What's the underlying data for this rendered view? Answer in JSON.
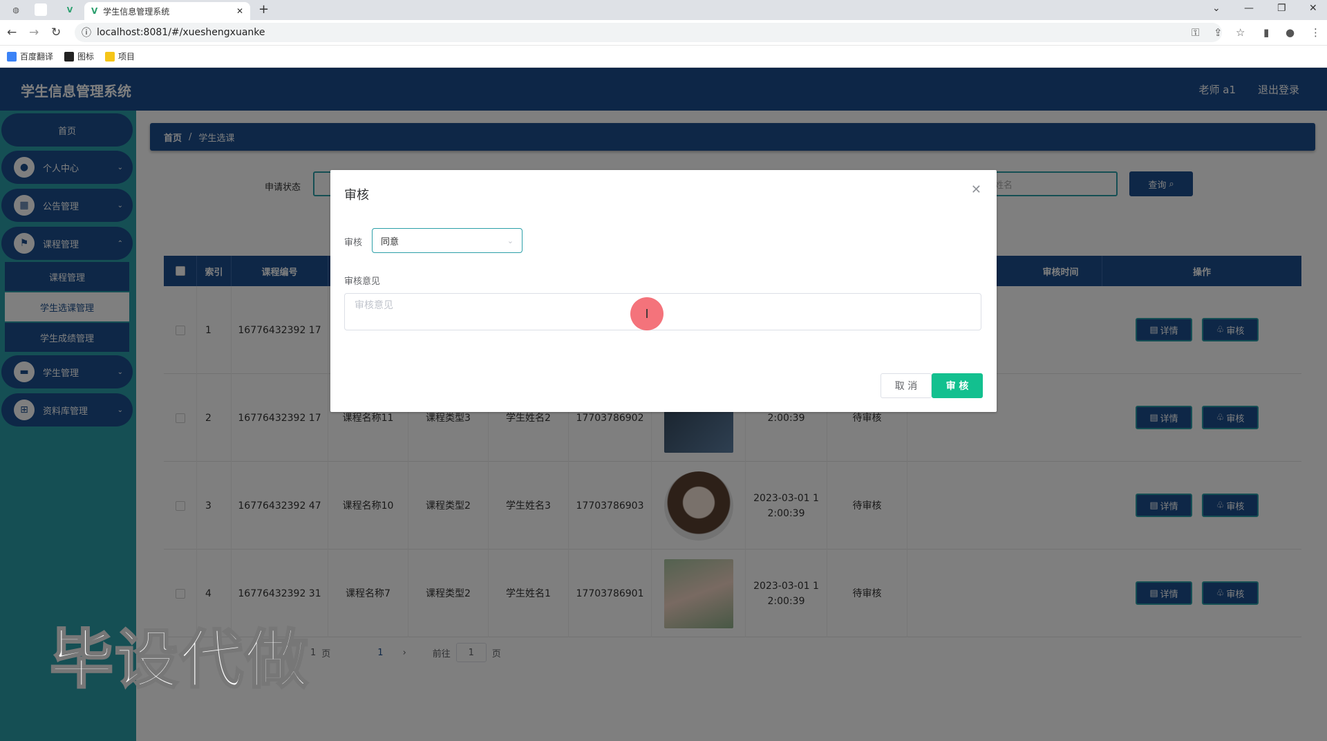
{
  "browser": {
    "tab_title": "学生信息管理系统",
    "url": "localhost:8081/#/xueshengxuanke",
    "bookmarks": [
      "百度翻译",
      "图标",
      "项目"
    ]
  },
  "header": {
    "brand": "学生信息管理系统",
    "user": "老师 a1",
    "logout": "退出登录"
  },
  "sidebar": {
    "home": "首页",
    "items": [
      {
        "label": "个人中心"
      },
      {
        "label": "公告管理"
      },
      {
        "label": "课程管理"
      },
      {
        "label": "学生管理"
      },
      {
        "label": "资料库管理"
      }
    ],
    "subitems": [
      "课程管理",
      "学生选课管理",
      "学生成绩管理"
    ]
  },
  "breadcrumb": {
    "home": "首页",
    "sep": "/",
    "current": "学生选课"
  },
  "search": {
    "status_label": "申请状态",
    "name_placeholder": "姓名",
    "query_button": "查询"
  },
  "table": {
    "headers": [
      "索引",
      "课程编号",
      "审核时间",
      "操作"
    ],
    "rows": [
      {
        "index": "1",
        "course_no": "16776432392 17",
        "course_name": "",
        "course_type": "",
        "student": "",
        "phone": "",
        "time": "",
        "status": ""
      },
      {
        "index": "2",
        "course_no": "16776432392 17",
        "course_name": "课程名称11",
        "course_type": "课程类型3",
        "student": "学生姓名2",
        "phone": "17703786902",
        "time": "2:00:39",
        "status": "待审核"
      },
      {
        "index": "3",
        "course_no": "16776432392 47",
        "course_name": "课程名称10",
        "course_type": "课程类型2",
        "student": "学生姓名3",
        "phone": "17703786903",
        "time": "2023-03-01 1 2:00:39",
        "status": "待审核"
      },
      {
        "index": "4",
        "course_no": "16776432392 31",
        "course_name": "课程名称7",
        "course_type": "课程类型2",
        "student": "学生姓名1",
        "phone": "17703786901",
        "time": "2023-03-01 1 2:00:39",
        "status": "待审核"
      }
    ],
    "detail_button": "详情",
    "review_button": "审核"
  },
  "pager": {
    "goto": "前往",
    "page": "1",
    "page_unit": "页",
    "page_size": "1",
    "page_size_unit": "页"
  },
  "watermark": "毕设代做",
  "dialog": {
    "title": "审核",
    "review_label": "审核",
    "review_value": "同意",
    "opinion_label": "审核意见",
    "opinion_placeholder": "审核意见",
    "cancel": "取 消",
    "confirm": "审 核"
  }
}
